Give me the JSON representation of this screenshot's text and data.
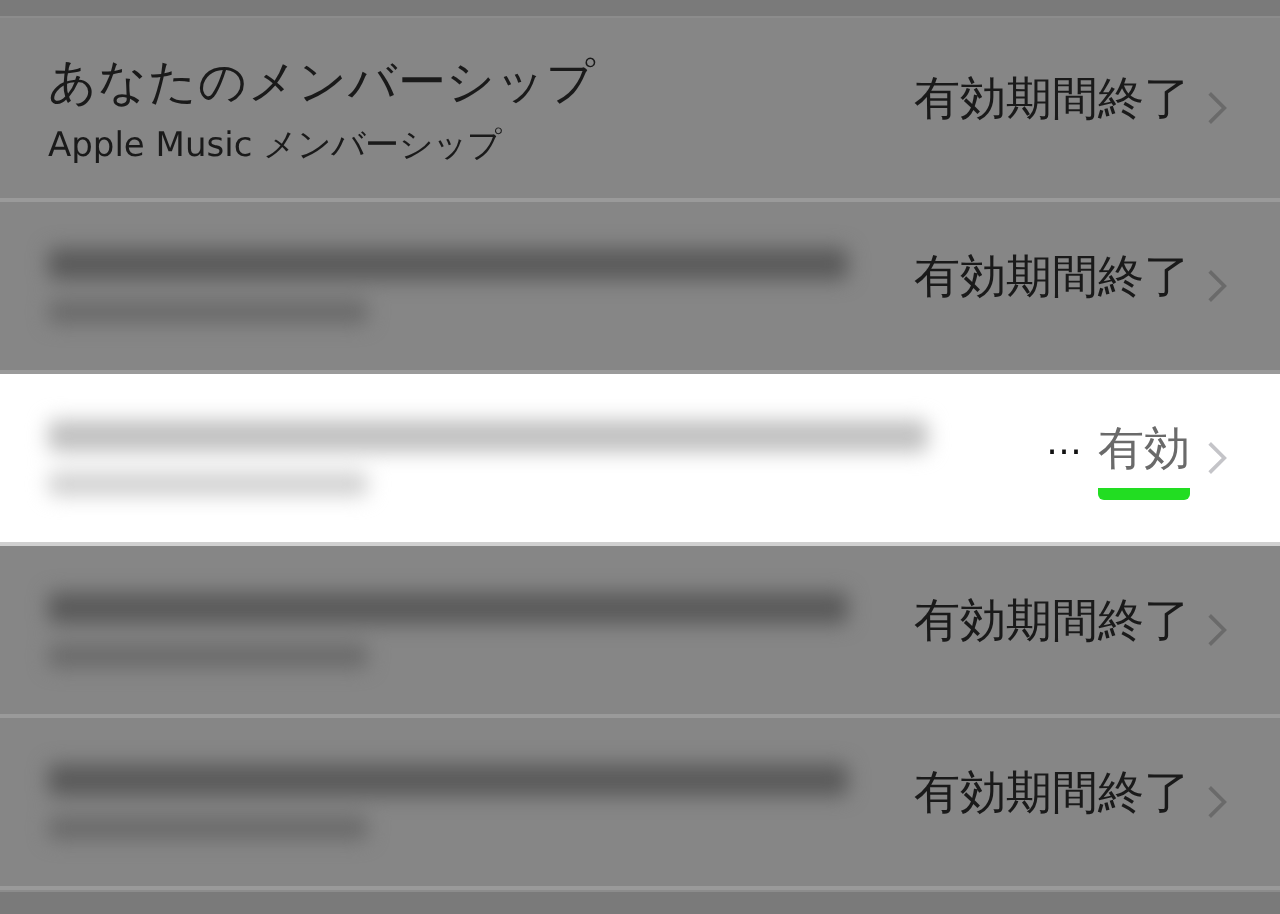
{
  "rows": [
    {
      "kind": "named",
      "title": "あなたのメンバーシップ",
      "subtitle": "Apple Music メンバーシップ",
      "status": "有効期間終了",
      "selected": false,
      "underlined": false
    },
    {
      "kind": "blurred",
      "status": "有効期間終了",
      "selected": false,
      "underlined": false
    },
    {
      "kind": "blurred",
      "badge": "…",
      "status": "有効",
      "selected": true,
      "underlined": true
    },
    {
      "kind": "blurred",
      "status": "有効期間終了",
      "selected": false,
      "underlined": false
    },
    {
      "kind": "blurred",
      "status": "有効期間終了",
      "selected": false,
      "underlined": false
    }
  ]
}
